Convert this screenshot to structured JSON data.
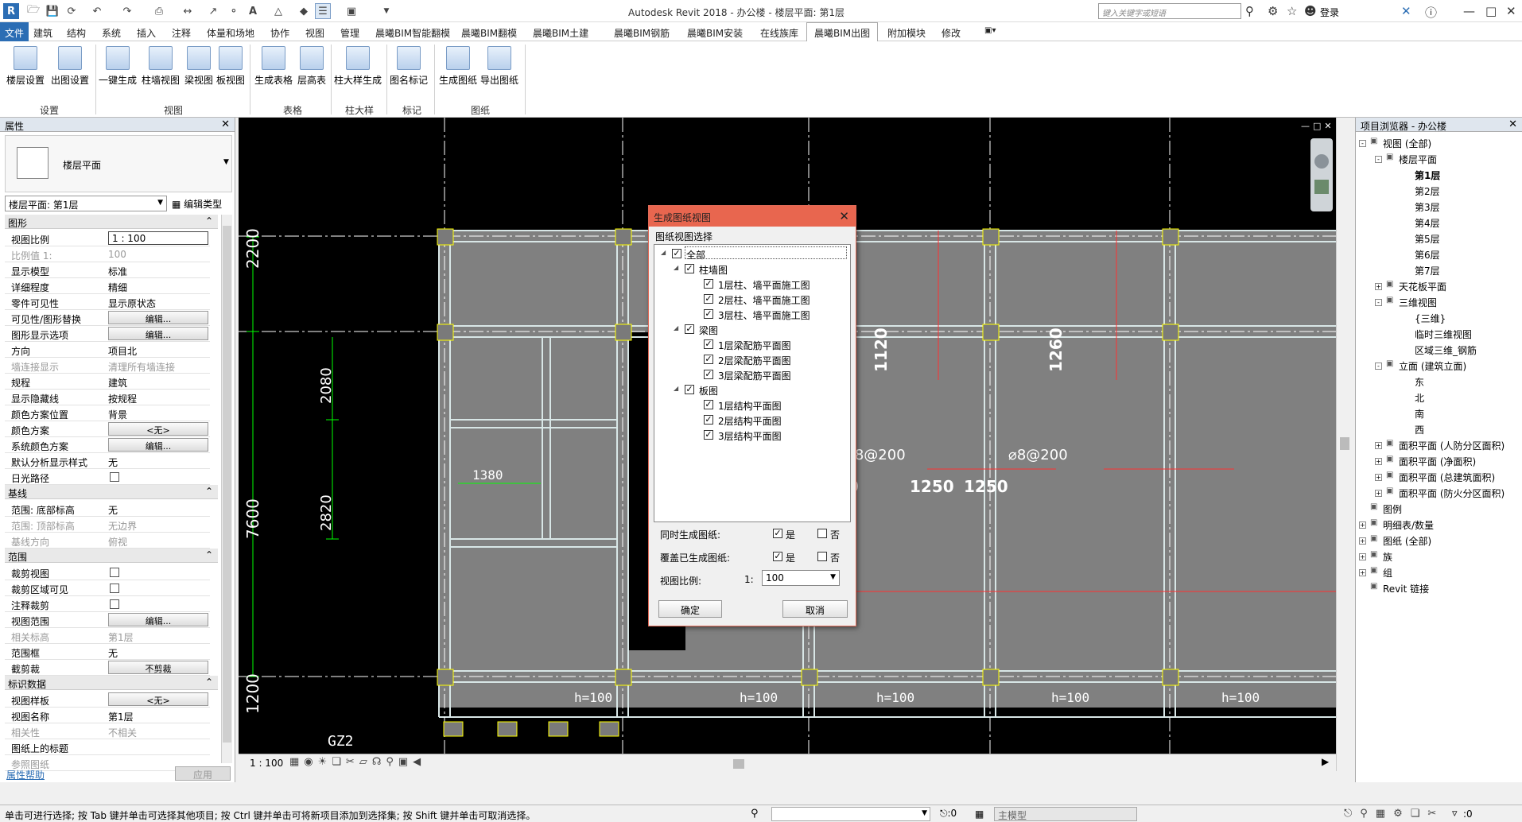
{
  "title_bar": {
    "app_title": "Autodesk Revit 2018 -    办公楼 - 楼层平面: 第1层",
    "search_placeholder": "键入关键字或短语",
    "login_label": "登录"
  },
  "ribbon_tabs": [
    "文件",
    "建筑",
    "结构",
    "系统",
    "插入",
    "注释",
    "体量和场地",
    "协作",
    "视图",
    "管理",
    "晨曦BIM智能翻模",
    "晨曦BIM翻模",
    "晨曦BIM土建",
    "晨曦BIM钢筋",
    "晨曦BIM安装",
    "在线族库",
    "晨曦BIM出图",
    "附加模块",
    "修改"
  ],
  "active_tab": "晨曦BIM出图",
  "ribbon_buttons": [
    "楼层设置",
    "出图设置",
    "一键生成",
    "柱墙视图",
    "梁视图",
    "板视图",
    "生成表格",
    "层高表",
    "柱大样生成",
    "图名标记",
    "生成图纸",
    "导出图纸"
  ],
  "ribbon_groups": [
    "设置",
    "视图",
    "表格",
    "柱大样",
    "标记",
    "图纸"
  ],
  "properties": {
    "title": "属性",
    "type_name": "楼层平面",
    "selector": "楼层平面: 第1层",
    "edit_type": "编辑类型",
    "sections": {
      "graphics": "图形",
      "underlay": "基线",
      "extents": "范围",
      "identity": "标识数据"
    },
    "graphics_rows": [
      {
        "k": "视图比例",
        "v": "1 : 100"
      },
      {
        "k": "比例值 1:",
        "v": "100"
      },
      {
        "k": "显示模型",
        "v": "标准"
      },
      {
        "k": "详细程度",
        "v": "精细"
      },
      {
        "k": "零件可见性",
        "v": "显示原状态"
      },
      {
        "k": "可见性/图形替换",
        "v": "编辑..."
      },
      {
        "k": "图形显示选项",
        "v": "编辑..."
      },
      {
        "k": "方向",
        "v": "项目北"
      },
      {
        "k": "墙连接显示",
        "v": "清理所有墙连接"
      },
      {
        "k": "规程",
        "v": "建筑"
      },
      {
        "k": "显示隐藏线",
        "v": "按规程"
      },
      {
        "k": "颜色方案位置",
        "v": "背景"
      },
      {
        "k": "颜色方案",
        "v": "<无>"
      },
      {
        "k": "系统颜色方案",
        "v": "编辑..."
      },
      {
        "k": "默认分析显示样式",
        "v": "无"
      },
      {
        "k": "日光路径",
        "v": ""
      }
    ],
    "underlay_rows": [
      {
        "k": "范围: 底部标高",
        "v": "无"
      },
      {
        "k": "范围: 顶部标高",
        "v": "无边界"
      },
      {
        "k": "基线方向",
        "v": "俯视"
      }
    ],
    "extent_rows": [
      {
        "k": "裁剪视图",
        "v": ""
      },
      {
        "k": "裁剪区域可见",
        "v": ""
      },
      {
        "k": "注释裁剪",
        "v": ""
      },
      {
        "k": "视图范围",
        "v": "编辑..."
      },
      {
        "k": "相关标高",
        "v": "第1层"
      },
      {
        "k": "范围框",
        "v": "无"
      },
      {
        "k": "截剪裁",
        "v": "不剪裁"
      }
    ],
    "identity_rows": [
      {
        "k": "视图样板",
        "v": "<无>"
      },
      {
        "k": "视图名称",
        "v": "第1层"
      },
      {
        "k": "相关性",
        "v": "不相关"
      },
      {
        "k": "图纸上的标题",
        "v": ""
      },
      {
        "k": "参照图纸",
        "v": ""
      }
    ],
    "help_link": "属性帮助",
    "apply_button": "应用"
  },
  "canvas": {
    "dims": [
      "2200",
      "2080",
      "2820",
      "7600",
      "1200"
    ],
    "rebar_labels": [
      "1120",
      "1120",
      "1260",
      "1120",
      "1120",
      "1250",
      "1250"
    ],
    "slab_labels": [
      "h=100",
      "h=100",
      "h=100",
      "h=100",
      "h=100"
    ],
    "tag_gz": "GZ2",
    "small_dim": "1380",
    "annot_1": "⌀8@200",
    "annot_2": "⌀8@200",
    "scale": "1 : 100"
  },
  "dialog": {
    "title": "生成图纸视图",
    "section_label": "图纸视图选择",
    "tree": {
      "root": "全部",
      "groups": [
        {
          "label": "柱墙图",
          "items": [
            "1层柱、墙平面施工图",
            "2层柱、墙平面施工图",
            "3层柱、墙平面施工图"
          ]
        },
        {
          "label": "梁图",
          "items": [
            "1层梁配筋平面图",
            "2层梁配筋平面图",
            "3层梁配筋平面图"
          ]
        },
        {
          "label": "板图",
          "items": [
            "1层结构平面图",
            "2层结构平面图",
            "3层结构平面图"
          ]
        }
      ]
    },
    "gen_sheets_label": "同时生成图纸:",
    "overwrite_label": "覆盖已生成图纸:",
    "yes": "是",
    "no": "否",
    "scale_label": "视图比例:",
    "scale_prefix": "1:",
    "scale_value": "100",
    "ok": "确定",
    "cancel": "取消"
  },
  "browser": {
    "title": "项目浏览器 - 办公楼",
    "nodes": [
      {
        "label": "视图 (全部)",
        "level": 0,
        "toggle": "-"
      },
      {
        "label": "楼层平面",
        "level": 1,
        "toggle": "-"
      },
      {
        "label": "第1层",
        "level": 2,
        "bold": true
      },
      {
        "label": "第2层",
        "level": 2
      },
      {
        "label": "第3层",
        "level": 2
      },
      {
        "label": "第4层",
        "level": 2
      },
      {
        "label": "第5层",
        "level": 2
      },
      {
        "label": "第6层",
        "level": 2
      },
      {
        "label": "第7层",
        "level": 2
      },
      {
        "label": "天花板平面",
        "level": 1,
        "toggle": "+"
      },
      {
        "label": "三维视图",
        "level": 1,
        "toggle": "-"
      },
      {
        "label": "{三维}",
        "level": 2
      },
      {
        "label": "临时三维视图",
        "level": 2
      },
      {
        "label": "区域三维_钢筋",
        "level": 2
      },
      {
        "label": "立面 (建筑立面)",
        "level": 1,
        "toggle": "-"
      },
      {
        "label": "东",
        "level": 2
      },
      {
        "label": "北",
        "level": 2
      },
      {
        "label": "南",
        "level": 2
      },
      {
        "label": "西",
        "level": 2
      },
      {
        "label": "面积平面 (人防分区面积)",
        "level": 1,
        "toggle": "+"
      },
      {
        "label": "面积平面 (净面积)",
        "level": 1,
        "toggle": "+"
      },
      {
        "label": "面积平面 (总建筑面积)",
        "level": 1,
        "toggle": "+"
      },
      {
        "label": "面积平面 (防火分区面积)",
        "level": 1,
        "toggle": "+"
      },
      {
        "label": "图例",
        "level": 0
      },
      {
        "label": "明细表/数量",
        "level": 0,
        "toggle": "+"
      },
      {
        "label": "图纸 (全部)",
        "level": 0,
        "toggle": "+"
      },
      {
        "label": "族",
        "level": 0,
        "toggle": "+"
      },
      {
        "label": "组",
        "level": 0,
        "toggle": "+"
      },
      {
        "label": "Revit 链接",
        "level": 0
      }
    ]
  },
  "status": {
    "text": "单击可进行选择; 按 Tab 键并单击可选择其他项目; 按 Ctrl 键并单击可将新项目添加到选择集; 按 Shift 键并单击可取消选择。",
    "model": "主模型",
    "count_a": ":0",
    "count_b": ":0"
  },
  "colors": {
    "accent": "#2b6db4",
    "dialog_head": "#e8664f",
    "canvas_bg": "#000000",
    "slab": "#808080",
    "rebar": "#ff3030",
    "grid": "#ffffff"
  }
}
